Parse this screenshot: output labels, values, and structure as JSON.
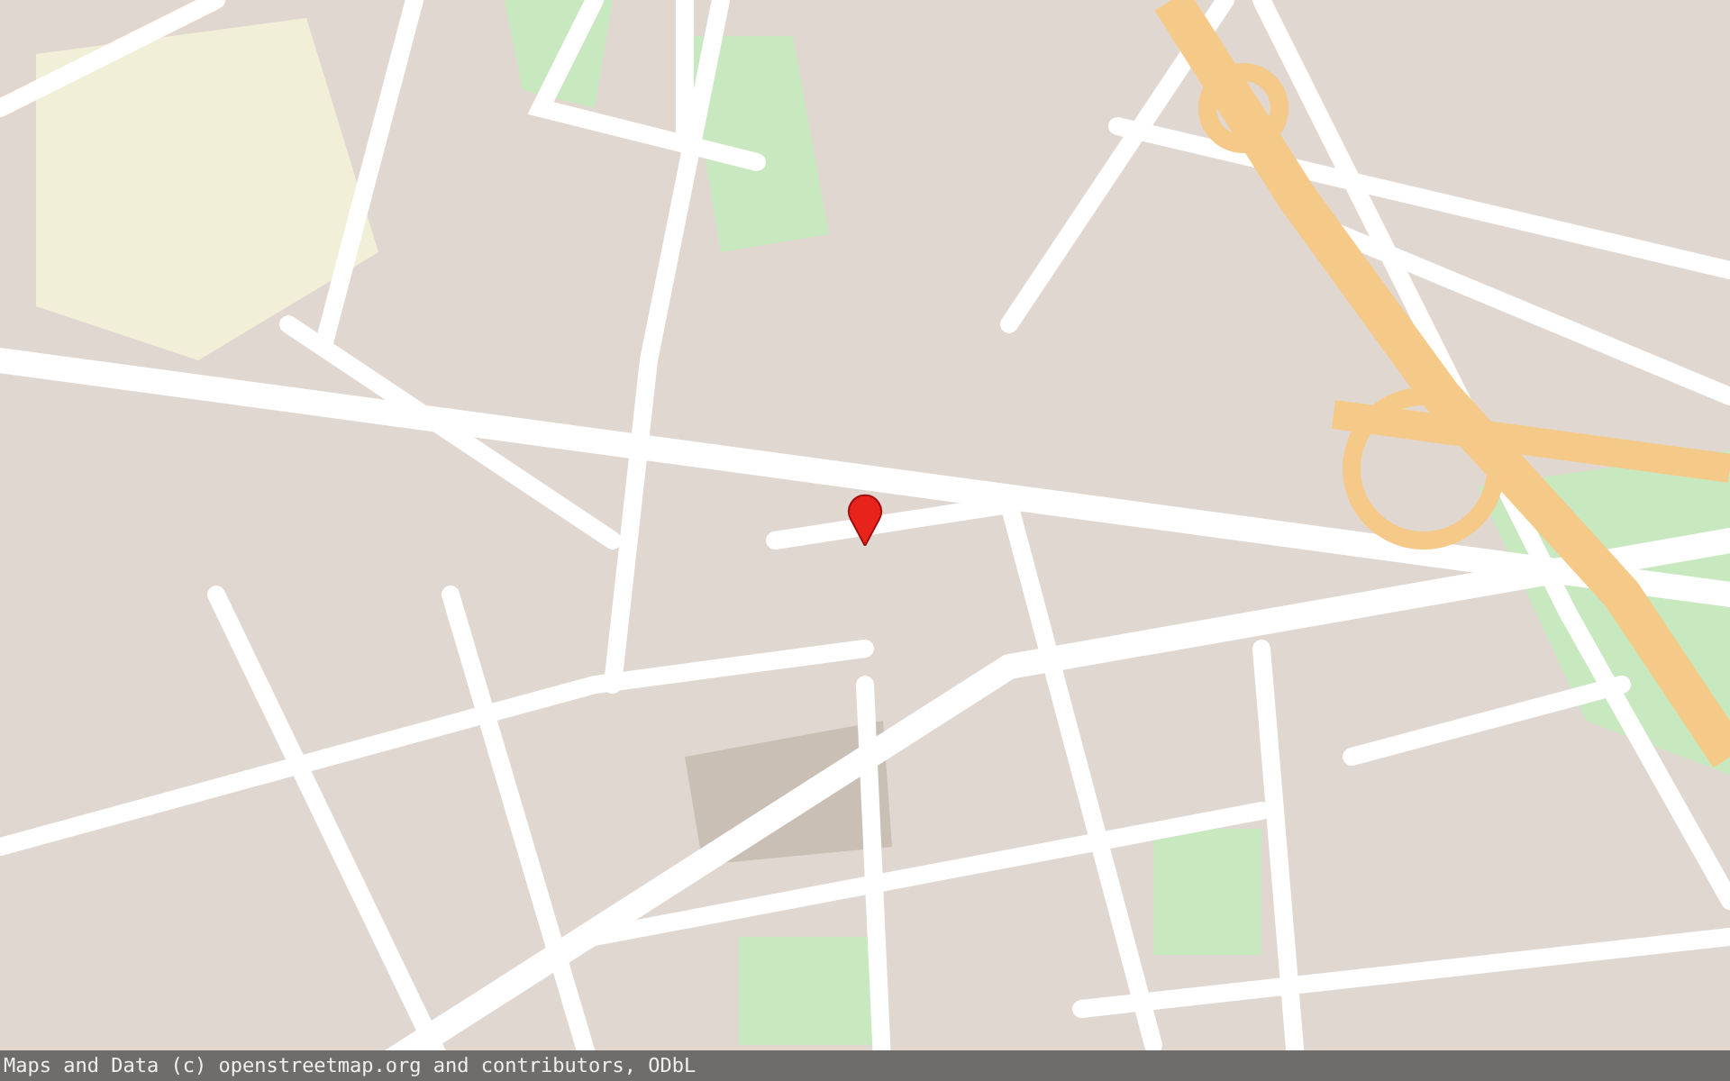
{
  "map": {
    "marker": {
      "shown": true
    }
  },
  "attribution": "Maps and Data (c) openstreetmap.org and contributors, ODbL"
}
